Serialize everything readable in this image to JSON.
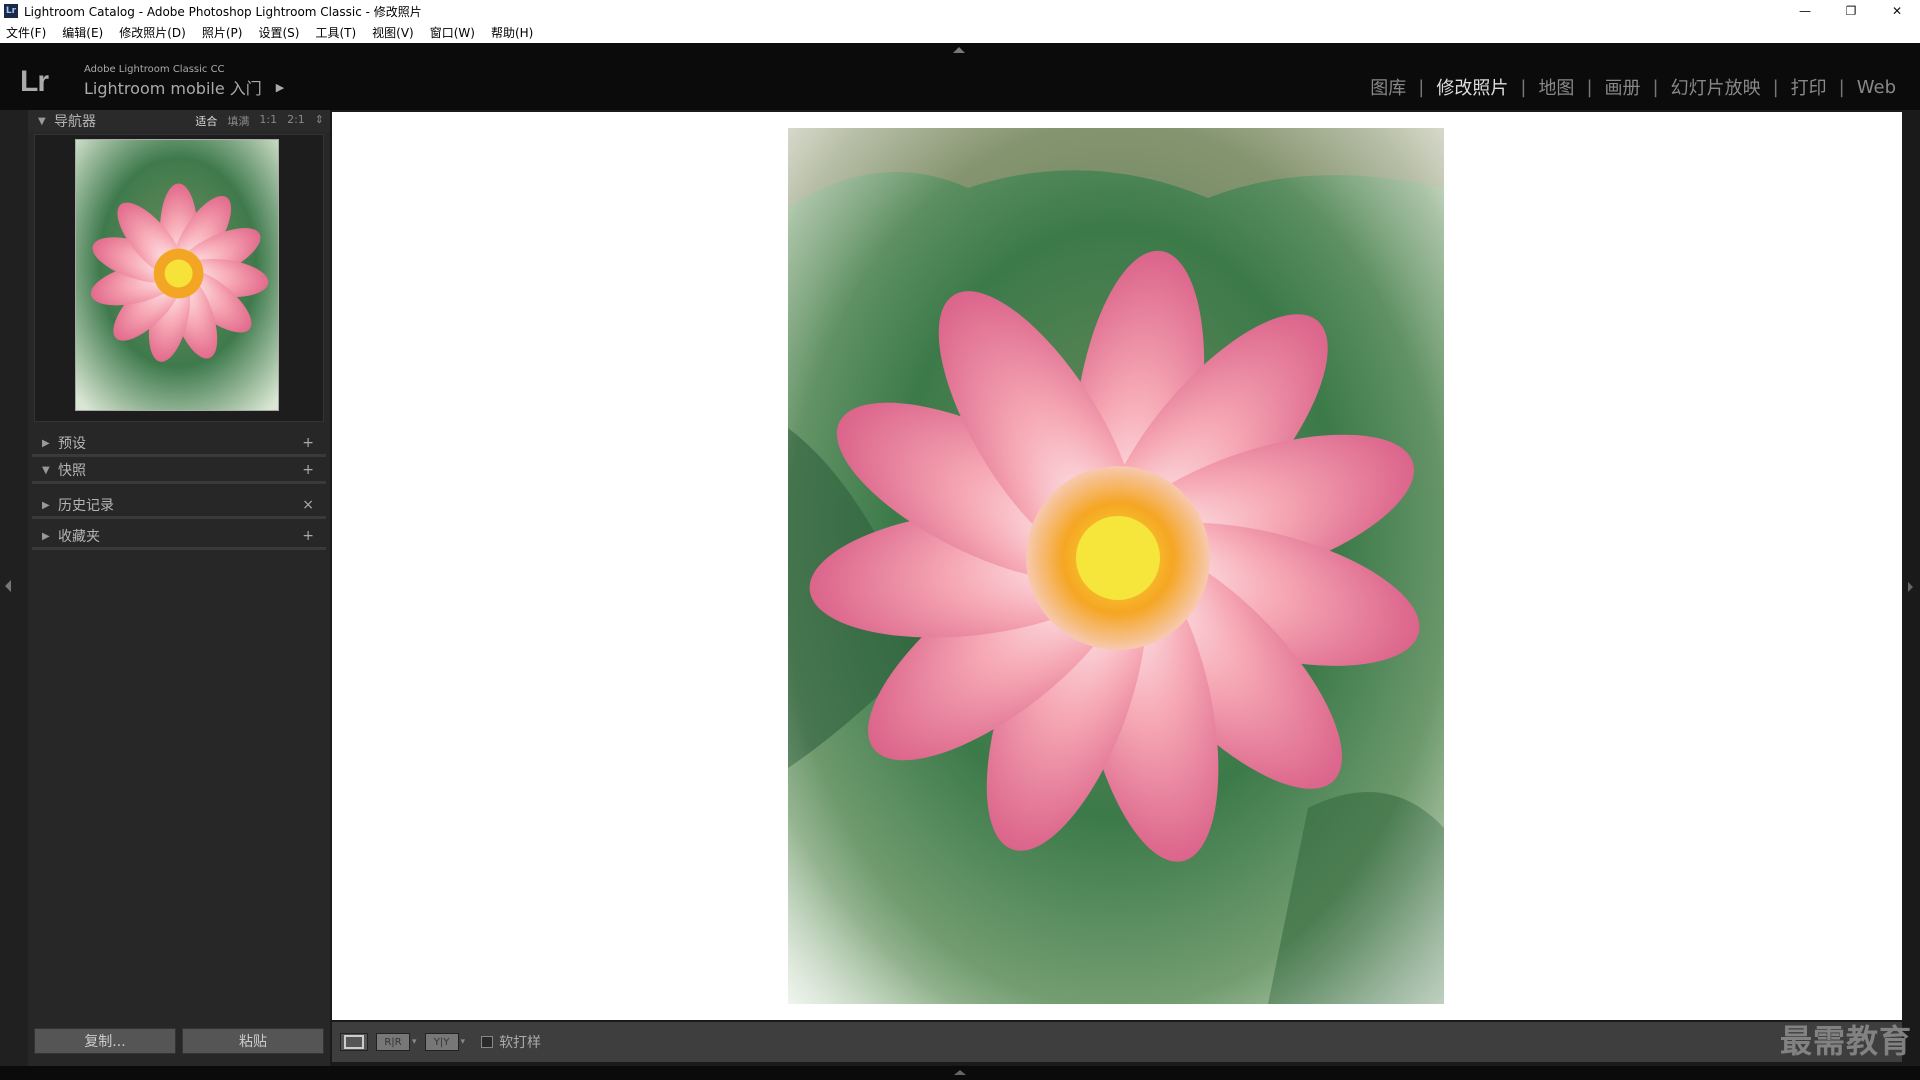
{
  "window": {
    "title": "Lightroom Catalog - Adobe Photoshop Lightroom Classic - 修改照片",
    "app_icon": "Lr",
    "minimize": "—",
    "restore": "❐",
    "close": "✕"
  },
  "menu": [
    "文件(F)",
    "编辑(E)",
    "修改照片(D)",
    "照片(P)",
    "设置(S)",
    "工具(T)",
    "视图(V)",
    "窗口(W)",
    "帮助(H)"
  ],
  "identity": {
    "logo": "Lr",
    "product": "Adobe Lightroom Classic CC",
    "mobile": "Lightroom mobile 入门",
    "arrow": "▶"
  },
  "modules": [
    {
      "label": "图库",
      "active": false
    },
    {
      "label": "修改照片",
      "active": true
    },
    {
      "label": "地图",
      "active": false
    },
    {
      "label": "画册",
      "active": false
    },
    {
      "label": "幻灯片放映",
      "active": false
    },
    {
      "label": "打印",
      "active": false
    },
    {
      "label": "Web",
      "active": false
    }
  ],
  "left_panel": {
    "navigator": {
      "title": "导航器",
      "zoom_options": [
        "适合",
        "填满",
        "1:1",
        "2:1"
      ],
      "active_zoom": "适合",
      "zoom_menu": "⇕"
    },
    "sections": [
      {
        "title": "预设",
        "expanded": false,
        "action": "+"
      },
      {
        "title": "快照",
        "expanded": true,
        "action": "+"
      },
      {
        "title": "历史记录",
        "expanded": false,
        "action": "×"
      },
      {
        "title": "收藏夹",
        "expanded": false,
        "action": "+"
      }
    ],
    "copy_button": "复制...",
    "paste_button": "粘贴"
  },
  "toolbar": {
    "ba_label": "R|R",
    "yy_label": "Y|Y",
    "soft_proof": "软打样",
    "soft_proof_checked": false
  },
  "watermark": "最需教育",
  "colors": {
    "background": "#1a1a1a",
    "panel": "#272727",
    "canvas": "#ffffff",
    "active_module": "#dddddd",
    "inactive_module": "#888888"
  }
}
